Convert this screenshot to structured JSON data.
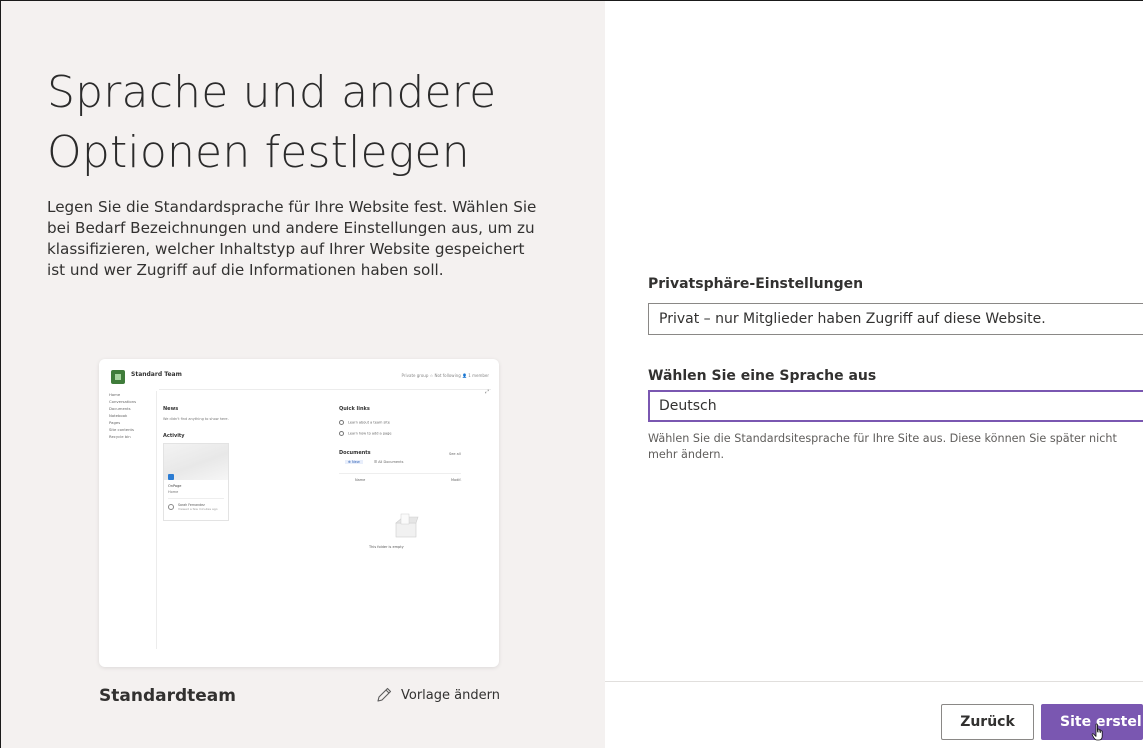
{
  "left": {
    "title": "Sprache und andere Optionen festlegen",
    "description": "Legen Sie die Standardsprache für Ihre Website fest. Wählen Sie bei Bedarf Bezeichnungen und andere Einstellungen aus, um zu klassifizieren, welcher Inhaltstyp auf Ihrer Website gespeichert ist und wer Zugriff auf die Informationen haben soll.",
    "preview": {
      "site_name": "Standard Team",
      "top_right": "Private group   ☆ Not following   👤 1 member",
      "nav": [
        "Home",
        "Conversations",
        "Documents",
        "Notebook",
        "Pages",
        "Site contents",
        "Recycle bin"
      ],
      "news_title": "News",
      "news_sub": "We didn't find anything to show here.",
      "activity_title": "Activity",
      "doc_title": "OnPage",
      "doc_sub": "Home",
      "doc_author": "Sarah Fernandez",
      "doc_author_sub": "Viewed a few minutes ago",
      "quick_links_title": "Quick links",
      "quick_links": [
        "Learn about a team site",
        "Learn how to add a page"
      ],
      "documents_title": "Documents",
      "see_all": "See all",
      "docbar_new": "⊕ New",
      "docbar_all": "☰ All Documents",
      "col_name": "Name",
      "col_modified": "Modif.",
      "empty_text": "This folder is empty"
    },
    "template_name": "Standardteam",
    "change_template": "Vorlage ändern"
  },
  "right": {
    "privacy_label": "Privatsphäre-Einstellungen",
    "privacy_value": "Privat – nur Mitglieder haben Zugriff auf diese Website.",
    "language_label": "Wählen Sie eine Sprache aus",
    "language_value": "Deutsch",
    "language_help": "Wählen Sie die Standardsitesprache für Ihre Site aus. Diese können Sie später nicht mehr ändern.",
    "back_button": "Zurück",
    "create_button": "Site erstellen"
  },
  "colors": {
    "accent": "#7a57b1",
    "left_background": "#f4f1f0"
  },
  "icons": {
    "pencil": "pencil-icon",
    "cursor": "hand-cursor-icon"
  }
}
